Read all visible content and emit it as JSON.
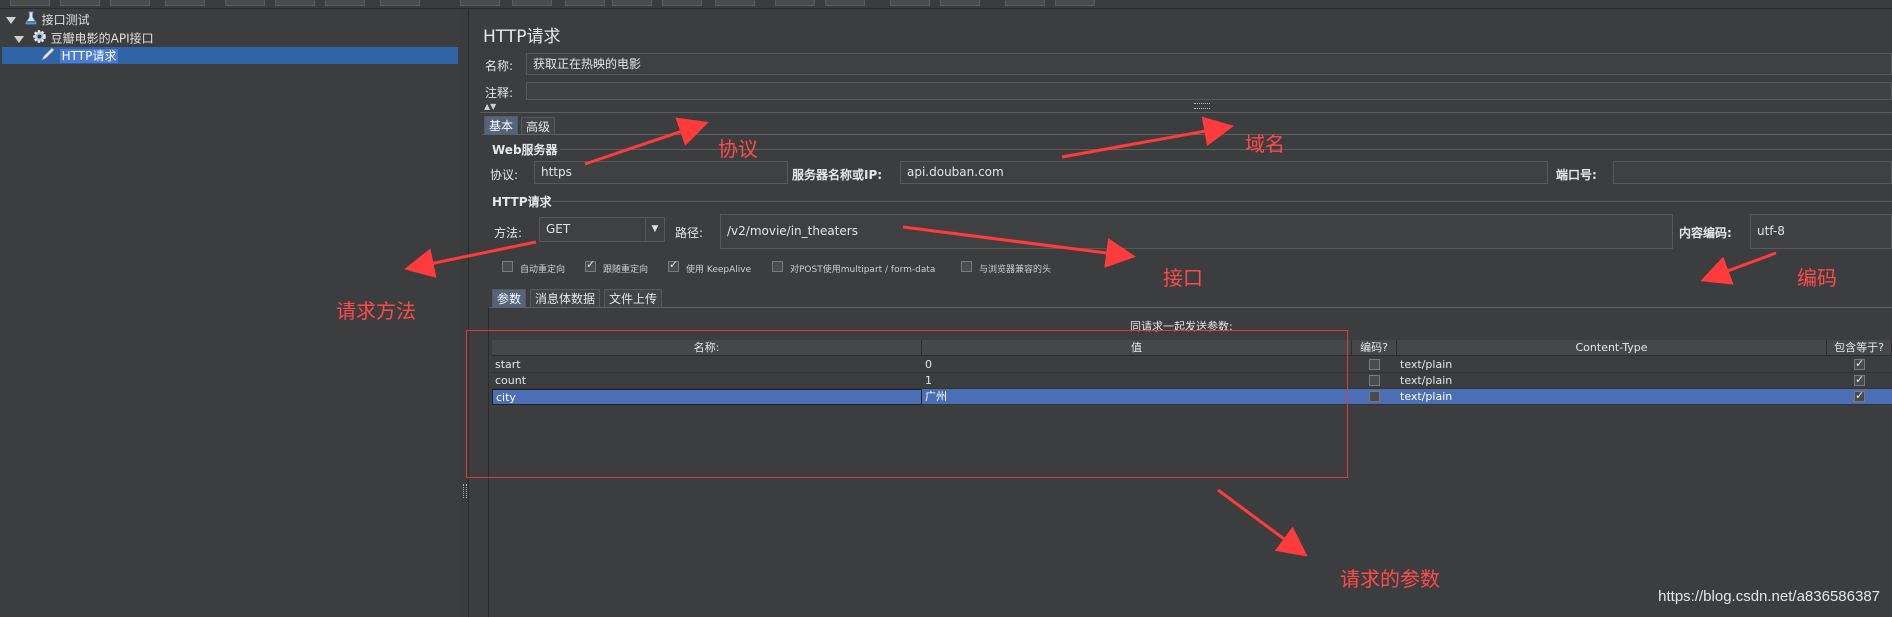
{
  "tree": {
    "items": [
      {
        "label": "接口测试",
        "icon": "flask-icon"
      },
      {
        "label": "豆瓣电影的API接口",
        "icon": "gear-icon"
      },
      {
        "label": "HTTP请求",
        "icon": "pen-icon"
      }
    ]
  },
  "panel": {
    "title": "HTTP请求",
    "name_label": "名称:",
    "name_value": "获取正在热映的电影",
    "comment_label": "注释:"
  },
  "tabs_top": [
    "基本",
    "高级"
  ],
  "web_server": {
    "group_title": "Web服务器",
    "protocol_label": "协议:",
    "protocol_value": "https",
    "server_label": "服务器名称或IP:",
    "server_value": "api.douban.com",
    "port_label": "端口号:",
    "port_value": ""
  },
  "http_request": {
    "group_title": "HTTP请求",
    "method_label": "方法:",
    "method_value": "GET",
    "path_label": "路径:",
    "path_value": "/v2/movie/in_theaters",
    "encoding_label": "内容编码:",
    "encoding_value": "utf-8"
  },
  "options": [
    {
      "label": "自动重定向",
      "checked": false
    },
    {
      "label": "跟随重定向",
      "checked": true
    },
    {
      "label": "使用 KeepAlive",
      "checked": true
    },
    {
      "label": "对POST使用multipart / form-data",
      "checked": false
    },
    {
      "label": "与浏览器兼容的头",
      "checked": false
    }
  ],
  "tabs_params": [
    "参数",
    "消息体数据",
    "文件上传"
  ],
  "params_title": "同请求一起发送参数:",
  "table": {
    "headers": [
      "名称:",
      "值",
      "编码?",
      "Content-Type",
      "包含等于?"
    ],
    "rows": [
      {
        "name": "start",
        "value": "0",
        "encode": false,
        "content_type": "text/plain",
        "include_equals": true
      },
      {
        "name": "count",
        "value": "1",
        "encode": false,
        "content_type": "text/plain",
        "include_equals": true
      },
      {
        "name": "city",
        "value": "广州",
        "encode": false,
        "content_type": "text/plain",
        "include_equals": true
      }
    ]
  },
  "annotations": {
    "protocol": "协议",
    "domain": "域名",
    "method": "请求方法",
    "interface": "接口",
    "encoding": "编码",
    "params": "请求的参数"
  },
  "watermark": "https://blog.csdn.net/a836586387",
  "colors": {
    "annotation": "#ff4a4a",
    "selection": "#4a6fb5",
    "background": "#3c3d3f"
  }
}
